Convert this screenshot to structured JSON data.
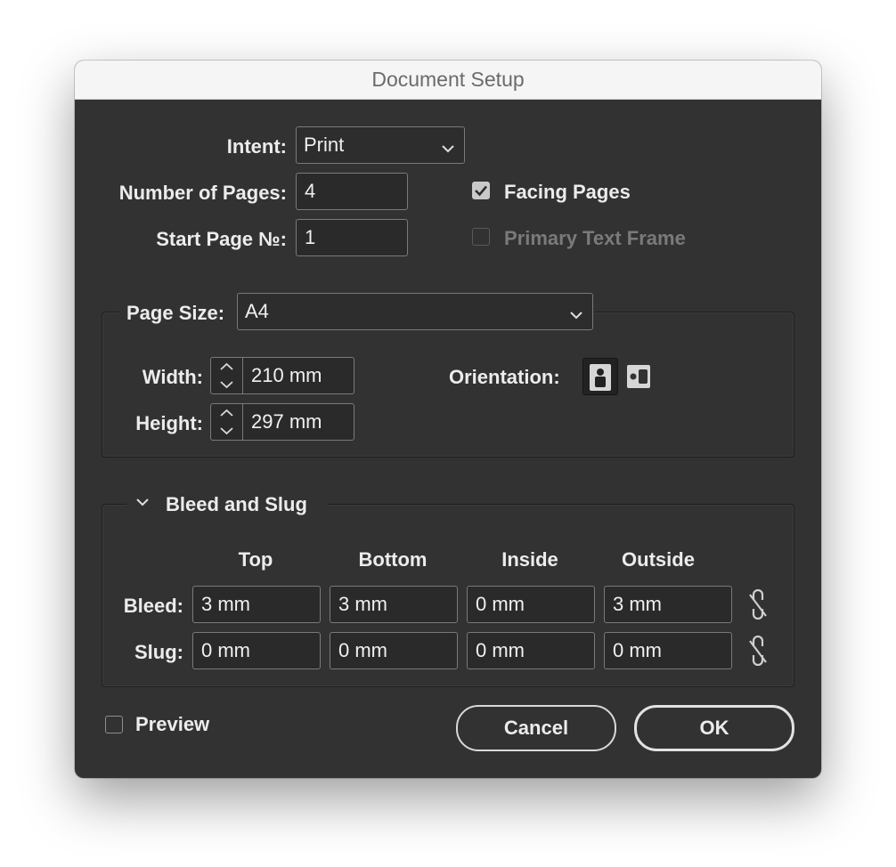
{
  "window": {
    "title": "Document Setup"
  },
  "intent": {
    "label": "Intent:",
    "value": "Print"
  },
  "pages": {
    "count_label": "Number of Pages:",
    "count_value": "4",
    "start_label": "Start Page №:",
    "start_value": "1"
  },
  "options": {
    "facing_pages": {
      "label": "Facing Pages",
      "checked": true
    },
    "primary_text_frame": {
      "label": "Primary Text Frame",
      "checked": false,
      "disabled": true
    }
  },
  "page_size": {
    "label": "Page Size:",
    "value": "A4",
    "width_label": "Width:",
    "width_value": "210 mm",
    "height_label": "Height:",
    "height_value": "297 mm",
    "orientation_label": "Orientation:",
    "orientation_selected": "portrait"
  },
  "bleed_slug": {
    "section_label": "Bleed and Slug",
    "columns": [
      "Top",
      "Bottom",
      "Inside",
      "Outside"
    ],
    "bleed_label": "Bleed:",
    "bleed_values": [
      "3 mm",
      "3 mm",
      "0 mm",
      "3 mm"
    ],
    "slug_label": "Slug:",
    "slug_values": [
      "0 mm",
      "0 mm",
      "0 mm",
      "0 mm"
    ]
  },
  "footer": {
    "preview_label": "Preview",
    "preview_checked": false,
    "cancel_label": "Cancel",
    "ok_label": "OK"
  },
  "icons": [
    "chevron-down-icon",
    "checkmark-icon",
    "stepper-arrows-icon",
    "portrait-orientation-icon",
    "landscape-orientation-icon",
    "disclosure-chevron-icon",
    "unlink-chain-icon"
  ]
}
